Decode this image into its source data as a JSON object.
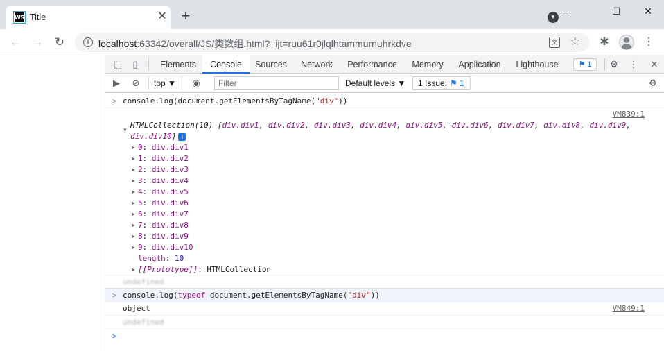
{
  "tab": {
    "title": "Title",
    "favicon_text": "WS"
  },
  "toolbar": {
    "url_host": "localhost",
    "url_rest": ":63342/overall/JS/类数组.html?_ijt=ruu61r0jlqlhtammurnuhrkdve"
  },
  "devtools": {
    "tabs": [
      "Elements",
      "Console",
      "Sources",
      "Network",
      "Performance",
      "Memory",
      "Application",
      "Lighthouse"
    ],
    "issue_count": "1"
  },
  "filterbar": {
    "context": "top",
    "filter_placeholder": "Filter",
    "levels": "Default levels",
    "issues_label": "1 Issue:",
    "issues_count": "1"
  },
  "console": {
    "cmd1_pre": "console.log(document.getElementsByTagName(",
    "cmd1_str": "\"div\"",
    "cmd1_post": "))",
    "src1": "VM839:1",
    "collection_prefix": "HTMLCollection(10) [",
    "collection_items": [
      "div.div1",
      "div.div2",
      "div.div3",
      "div.div4",
      "div.div5",
      "div.div6",
      "div.div7",
      "div.div8",
      "div.div9"
    ],
    "collection_last": "div.div10",
    "entries": [
      {
        "key": "0",
        "val": "div.div1"
      },
      {
        "key": "1",
        "val": "div.div2"
      },
      {
        "key": "2",
        "val": "div.div3"
      },
      {
        "key": "3",
        "val": "div.div4"
      },
      {
        "key": "4",
        "val": "div.div5"
      },
      {
        "key": "5",
        "val": "div.div6"
      },
      {
        "key": "6",
        "val": "div.div7"
      },
      {
        "key": "7",
        "val": "div.div8"
      },
      {
        "key": "8",
        "val": "div.div9"
      },
      {
        "key": "9",
        "val": "div.div10"
      }
    ],
    "length_key": "length",
    "length_val": "10",
    "proto_key": "[[Prototype]]",
    "proto_val": "HTMLCollection",
    "undefined_text": "undefined",
    "cmd2_pre": "console.log(",
    "cmd2_kw": "typeof",
    "cmd2_mid": " document.getElementsByTagName(",
    "cmd2_str": "\"div\"",
    "cmd2_post": "))",
    "result2": "object",
    "src2": "VM849:1"
  }
}
